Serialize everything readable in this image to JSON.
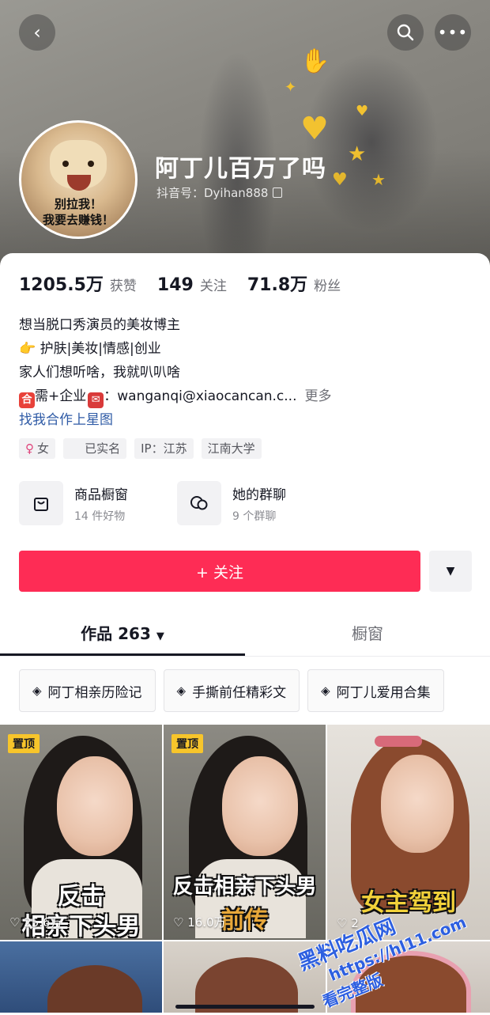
{
  "header": {
    "name": "阿丁儿百万了吗",
    "douyin_id": "抖音号：Dyihan888",
    "avatar_caption_line1": "别拉我！",
    "avatar_caption_line2": "我要去赚钱！"
  },
  "stats": [
    {
      "value": "1205.5万",
      "label": "获赞"
    },
    {
      "value": "149",
      "label": "关注"
    },
    {
      "value": "71.8万",
      "label": "粉丝"
    }
  ],
  "bio": {
    "line1": "想当脱口秀演员的美妆博主",
    "line2": "护肤|美妆|情感|创业",
    "line3": "家人们想听啥，我就叭叭啥",
    "line4_a": "需+企业",
    "line4_b": "：wanganqi@xiaocancan.c...",
    "more": "更多",
    "link": "找我合作上星图"
  },
  "tags": [
    "女",
    "已实名",
    "IP：江苏",
    "江南大学"
  ],
  "shortcuts": [
    {
      "title": "商品橱窗",
      "subtitle": "14 件好物",
      "icon": "shopping-bag-icon"
    },
    {
      "title": "她的群聊",
      "subtitle": "9 个群聊",
      "icon": "chat-bubbles-icon"
    }
  ],
  "follow_label": "+ 关注",
  "tabs": {
    "works": "作品 263",
    "showcase": "橱窗"
  },
  "collections": [
    "阿丁相亲历险记",
    "手撕前任精彩文",
    "阿丁儿爱用合集"
  ],
  "videos": [
    {
      "pinned": "置顶",
      "caption_top": "反击",
      "caption_bottom": "相亲下头男",
      "likes": "25.6万"
    },
    {
      "pinned": "置顶",
      "caption_top": "反击相亲下头男",
      "caption_bottom": "前传",
      "likes": "16.0万"
    },
    {
      "caption": "女主驾到",
      "likes": "2"
    }
  ],
  "watermark": {
    "line1": "黑料吃瓜网",
    "line2": "https://hl11.com",
    "line3": "看完整版"
  },
  "colors": {
    "accent": "#fe2c55",
    "link": "#2f5ba6",
    "pin": "#f7c52b"
  }
}
